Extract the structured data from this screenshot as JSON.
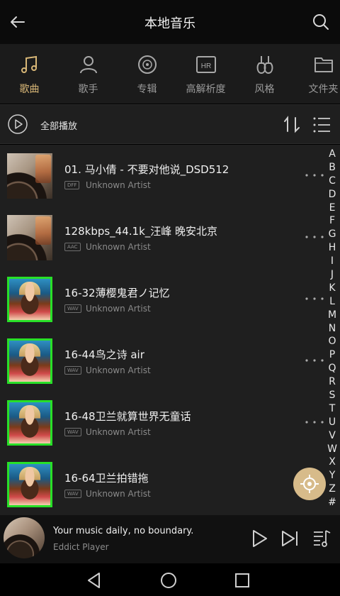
{
  "header": {
    "title": "本地音乐"
  },
  "tabs": [
    {
      "label": "歌曲",
      "icon": "music-note-icon",
      "active": true
    },
    {
      "label": "歌手",
      "icon": "person-icon",
      "active": false
    },
    {
      "label": "专辑",
      "icon": "disc-icon",
      "active": false
    },
    {
      "label": "高解析度",
      "icon": "hr-icon",
      "active": false
    },
    {
      "label": "风格",
      "icon": "guitar-icon",
      "active": false
    },
    {
      "label": "文件夹",
      "icon": "folder-icon",
      "active": false
    }
  ],
  "toolbar": {
    "play_all_label": "全部播放"
  },
  "songs": [
    {
      "title": "01. 马小倩 - 不要对他说_DSD512",
      "format": "DFF",
      "artist": "Unknown Artist",
      "cover": "vinyl-cover"
    },
    {
      "title": "128kbps_44.1k_汪峰 晚安北京",
      "format": "AAC",
      "artist": "Unknown Artist",
      "cover": "vinyl-cover"
    },
    {
      "title": "16-32薄樱鬼君ノ记忆",
      "format": "WAV",
      "artist": "Unknown Artist",
      "cover": "photo-cover"
    },
    {
      "title": "16-44鸟之诗 air",
      "format": "WAV",
      "artist": "Unknown Artist",
      "cover": "photo-cover"
    },
    {
      "title": "16-48卫兰就算世界无童话",
      "format": "WAV",
      "artist": "Unknown Artist",
      "cover": "photo-cover"
    },
    {
      "title": "16-64卫兰拍错拖",
      "format": "WAV",
      "artist": "Unknown Artist",
      "cover": "photo-cover"
    }
  ],
  "alphabet": [
    "A",
    "B",
    "C",
    "D",
    "E",
    "F",
    "G",
    "H",
    "I",
    "J",
    "K",
    "L",
    "M",
    "N",
    "O",
    "P",
    "Q",
    "R",
    "S",
    "T",
    "U",
    "V",
    "W",
    "X",
    "Y",
    "Z",
    "#"
  ],
  "mini_player": {
    "line1": "Your music daily, no boundary.",
    "line2": "Eddict Player"
  },
  "colors": {
    "accent": "#d8b777",
    "background": "#1f1f1f",
    "header": "#0b0b0b",
    "fab": "#d7bb8a",
    "cover_border": "#28e028"
  }
}
